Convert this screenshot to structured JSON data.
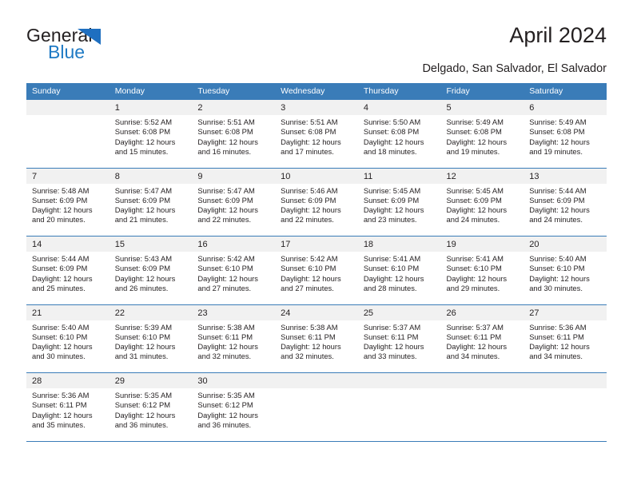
{
  "brand": {
    "name_part1": "General",
    "name_part2": "Blue",
    "triangle_color": "#1f6fc0",
    "blue_text_color": "#1f7ac4"
  },
  "header": {
    "title": "April 2024",
    "subtitle": "Delgado, San Salvador, El Salvador",
    "accent_color": "#3a7cb8",
    "daynum_bg": "#f1f1f1"
  },
  "weekdays": [
    "Sunday",
    "Monday",
    "Tuesday",
    "Wednesday",
    "Thursday",
    "Friday",
    "Saturday"
  ],
  "labels": {
    "sunrise_prefix": "Sunrise:",
    "sunset_prefix": "Sunset:",
    "daylight_prefix": "Daylight:"
  },
  "weeks": [
    [
      {
        "day": "",
        "sunrise": "",
        "sunset": "",
        "daylight_line1": "",
        "daylight_line2": ""
      },
      {
        "day": "1",
        "sunrise": "Sunrise: 5:52 AM",
        "sunset": "Sunset: 6:08 PM",
        "daylight_line1": "Daylight: 12 hours",
        "daylight_line2": "and 15 minutes."
      },
      {
        "day": "2",
        "sunrise": "Sunrise: 5:51 AM",
        "sunset": "Sunset: 6:08 PM",
        "daylight_line1": "Daylight: 12 hours",
        "daylight_line2": "and 16 minutes."
      },
      {
        "day": "3",
        "sunrise": "Sunrise: 5:51 AM",
        "sunset": "Sunset: 6:08 PM",
        "daylight_line1": "Daylight: 12 hours",
        "daylight_line2": "and 17 minutes."
      },
      {
        "day": "4",
        "sunrise": "Sunrise: 5:50 AM",
        "sunset": "Sunset: 6:08 PM",
        "daylight_line1": "Daylight: 12 hours",
        "daylight_line2": "and 18 minutes."
      },
      {
        "day": "5",
        "sunrise": "Sunrise: 5:49 AM",
        "sunset": "Sunset: 6:08 PM",
        "daylight_line1": "Daylight: 12 hours",
        "daylight_line2": "and 19 minutes."
      },
      {
        "day": "6",
        "sunrise": "Sunrise: 5:49 AM",
        "sunset": "Sunset: 6:08 PM",
        "daylight_line1": "Daylight: 12 hours",
        "daylight_line2": "and 19 minutes."
      }
    ],
    [
      {
        "day": "7",
        "sunrise": "Sunrise: 5:48 AM",
        "sunset": "Sunset: 6:09 PM",
        "daylight_line1": "Daylight: 12 hours",
        "daylight_line2": "and 20 minutes."
      },
      {
        "day": "8",
        "sunrise": "Sunrise: 5:47 AM",
        "sunset": "Sunset: 6:09 PM",
        "daylight_line1": "Daylight: 12 hours",
        "daylight_line2": "and 21 minutes."
      },
      {
        "day": "9",
        "sunrise": "Sunrise: 5:47 AM",
        "sunset": "Sunset: 6:09 PM",
        "daylight_line1": "Daylight: 12 hours",
        "daylight_line2": "and 22 minutes."
      },
      {
        "day": "10",
        "sunrise": "Sunrise: 5:46 AM",
        "sunset": "Sunset: 6:09 PM",
        "daylight_line1": "Daylight: 12 hours",
        "daylight_line2": "and 22 minutes."
      },
      {
        "day": "11",
        "sunrise": "Sunrise: 5:45 AM",
        "sunset": "Sunset: 6:09 PM",
        "daylight_line1": "Daylight: 12 hours",
        "daylight_line2": "and 23 minutes."
      },
      {
        "day": "12",
        "sunrise": "Sunrise: 5:45 AM",
        "sunset": "Sunset: 6:09 PM",
        "daylight_line1": "Daylight: 12 hours",
        "daylight_line2": "and 24 minutes."
      },
      {
        "day": "13",
        "sunrise": "Sunrise: 5:44 AM",
        "sunset": "Sunset: 6:09 PM",
        "daylight_line1": "Daylight: 12 hours",
        "daylight_line2": "and 24 minutes."
      }
    ],
    [
      {
        "day": "14",
        "sunrise": "Sunrise: 5:44 AM",
        "sunset": "Sunset: 6:09 PM",
        "daylight_line1": "Daylight: 12 hours",
        "daylight_line2": "and 25 minutes."
      },
      {
        "day": "15",
        "sunrise": "Sunrise: 5:43 AM",
        "sunset": "Sunset: 6:09 PM",
        "daylight_line1": "Daylight: 12 hours",
        "daylight_line2": "and 26 minutes."
      },
      {
        "day": "16",
        "sunrise": "Sunrise: 5:42 AM",
        "sunset": "Sunset: 6:10 PM",
        "daylight_line1": "Daylight: 12 hours",
        "daylight_line2": "and 27 minutes."
      },
      {
        "day": "17",
        "sunrise": "Sunrise: 5:42 AM",
        "sunset": "Sunset: 6:10 PM",
        "daylight_line1": "Daylight: 12 hours",
        "daylight_line2": "and 27 minutes."
      },
      {
        "day": "18",
        "sunrise": "Sunrise: 5:41 AM",
        "sunset": "Sunset: 6:10 PM",
        "daylight_line1": "Daylight: 12 hours",
        "daylight_line2": "and 28 minutes."
      },
      {
        "day": "19",
        "sunrise": "Sunrise: 5:41 AM",
        "sunset": "Sunset: 6:10 PM",
        "daylight_line1": "Daylight: 12 hours",
        "daylight_line2": "and 29 minutes."
      },
      {
        "day": "20",
        "sunrise": "Sunrise: 5:40 AM",
        "sunset": "Sunset: 6:10 PM",
        "daylight_line1": "Daylight: 12 hours",
        "daylight_line2": "and 30 minutes."
      }
    ],
    [
      {
        "day": "21",
        "sunrise": "Sunrise: 5:40 AM",
        "sunset": "Sunset: 6:10 PM",
        "daylight_line1": "Daylight: 12 hours",
        "daylight_line2": "and 30 minutes."
      },
      {
        "day": "22",
        "sunrise": "Sunrise: 5:39 AM",
        "sunset": "Sunset: 6:10 PM",
        "daylight_line1": "Daylight: 12 hours",
        "daylight_line2": "and 31 minutes."
      },
      {
        "day": "23",
        "sunrise": "Sunrise: 5:38 AM",
        "sunset": "Sunset: 6:11 PM",
        "daylight_line1": "Daylight: 12 hours",
        "daylight_line2": "and 32 minutes."
      },
      {
        "day": "24",
        "sunrise": "Sunrise: 5:38 AM",
        "sunset": "Sunset: 6:11 PM",
        "daylight_line1": "Daylight: 12 hours",
        "daylight_line2": "and 32 minutes."
      },
      {
        "day": "25",
        "sunrise": "Sunrise: 5:37 AM",
        "sunset": "Sunset: 6:11 PM",
        "daylight_line1": "Daylight: 12 hours",
        "daylight_line2": "and 33 minutes."
      },
      {
        "day": "26",
        "sunrise": "Sunrise: 5:37 AM",
        "sunset": "Sunset: 6:11 PM",
        "daylight_line1": "Daylight: 12 hours",
        "daylight_line2": "and 34 minutes."
      },
      {
        "day": "27",
        "sunrise": "Sunrise: 5:36 AM",
        "sunset": "Sunset: 6:11 PM",
        "daylight_line1": "Daylight: 12 hours",
        "daylight_line2": "and 34 minutes."
      }
    ],
    [
      {
        "day": "28",
        "sunrise": "Sunrise: 5:36 AM",
        "sunset": "Sunset: 6:11 PM",
        "daylight_line1": "Daylight: 12 hours",
        "daylight_line2": "and 35 minutes."
      },
      {
        "day": "29",
        "sunrise": "Sunrise: 5:35 AM",
        "sunset": "Sunset: 6:12 PM",
        "daylight_line1": "Daylight: 12 hours",
        "daylight_line2": "and 36 minutes."
      },
      {
        "day": "30",
        "sunrise": "Sunrise: 5:35 AM",
        "sunset": "Sunset: 6:12 PM",
        "daylight_line1": "Daylight: 12 hours",
        "daylight_line2": "and 36 minutes."
      },
      {
        "day": "",
        "sunrise": "",
        "sunset": "",
        "daylight_line1": "",
        "daylight_line2": ""
      },
      {
        "day": "",
        "sunrise": "",
        "sunset": "",
        "daylight_line1": "",
        "daylight_line2": ""
      },
      {
        "day": "",
        "sunrise": "",
        "sunset": "",
        "daylight_line1": "",
        "daylight_line2": ""
      },
      {
        "day": "",
        "sunrise": "",
        "sunset": "",
        "daylight_line1": "",
        "daylight_line2": ""
      }
    ]
  ]
}
